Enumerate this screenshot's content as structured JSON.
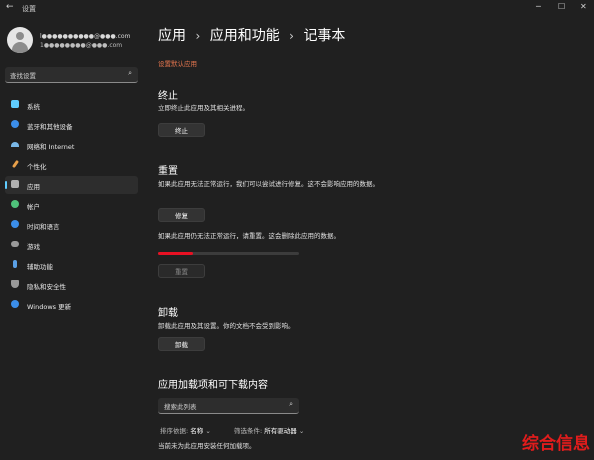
{
  "window": {
    "back_icon": "back-arrow-icon",
    "title": "设置"
  },
  "account": {
    "name": "l●●●●●●●●●●@●●●.com",
    "email": "1●●●●●●●●@●●●.com"
  },
  "sidebar": {
    "search_placeholder": "查找设置",
    "items": [
      {
        "label": "系统",
        "icon": "monitor-icon",
        "color": "#60cdff"
      },
      {
        "label": "蓝牙和其他设备",
        "icon": "bluetooth-icon",
        "color": "#3b8eea"
      },
      {
        "label": "网络和 Internet",
        "icon": "wifi-icon",
        "color": "#7ab8e8"
      },
      {
        "label": "个性化",
        "icon": "brush-icon",
        "color": "#e8a04a"
      },
      {
        "label": "应用",
        "icon": "apps-icon",
        "color": "#b0b0b0"
      },
      {
        "label": "帐户",
        "icon": "account-icon",
        "color": "#4fc27a"
      },
      {
        "label": "时间和语言",
        "icon": "clock-globe-icon",
        "color": "#3b8eea"
      },
      {
        "label": "游戏",
        "icon": "gamepad-icon",
        "color": "#9a9a9a"
      },
      {
        "label": "辅助功能",
        "icon": "accessibility-icon",
        "color": "#5aa0e6"
      },
      {
        "label": "隐私和安全性",
        "icon": "shield-icon",
        "color": "#9a9a9a"
      },
      {
        "label": "Windows 更新",
        "icon": "update-icon",
        "color": "#3b8eea"
      }
    ],
    "active_index": 4
  },
  "breadcrumb": {
    "level1": "应用",
    "level2": "应用和功能",
    "level3": "记事本",
    "separator": "›"
  },
  "default_link": "设置默认应用",
  "terminate": {
    "heading": "终止",
    "desc": "立即终止此应用及其相关进程。",
    "button": "终止"
  },
  "reset": {
    "heading": "重置",
    "repair_desc": "如果此应用无法正常运行，我们可以尝试进行修复。这不会影响应用的数据。",
    "repair_button": "修复",
    "reset_desc": "如果此应用仍无法正常运行，请重置。这会删除此应用的数据。",
    "progress": 0.25,
    "reset_button": "重置"
  },
  "uninstall": {
    "heading": "卸载",
    "desc": "卸载此应用及其设置。你的文档不会受到影响。",
    "button": "卸载"
  },
  "addons": {
    "heading": "应用加载项和可下载内容",
    "search_placeholder": "搜索此列表",
    "sort_label": "排序依据:",
    "sort_value": "名称",
    "filter_label": "筛选条件:",
    "filter_value": "所有驱动器",
    "empty": "当前未为此应用安装任何加载项。"
  },
  "watermark": "综合信息"
}
